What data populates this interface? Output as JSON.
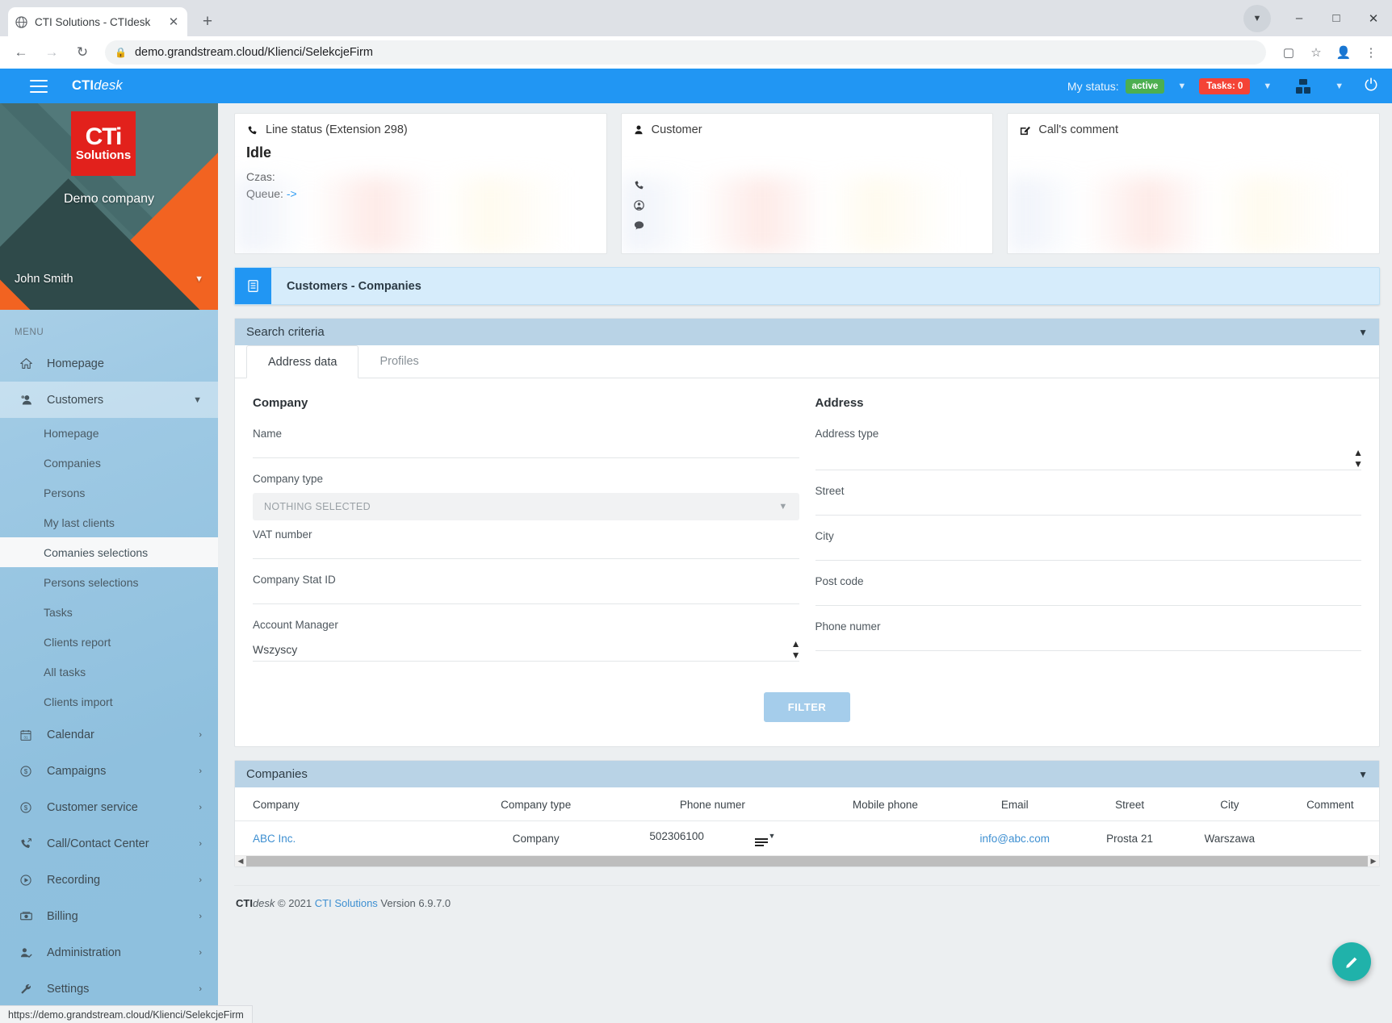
{
  "browser": {
    "tab_title": "CTI Solutions - CTIdesk",
    "tab_favicon": "globe-icon",
    "new_tab": "+",
    "url": "demo.grandstream.cloud/Klienci/SelekcjeFirm",
    "status_url": "https://demo.grandstream.cloud/Klienci/SelekcjeFirm",
    "minimize": "–",
    "maximize": "□",
    "close": "✕"
  },
  "topbar": {
    "brand_bold": "CTI",
    "brand_italic": "desk",
    "status_label": "My status:",
    "status_value": "active",
    "tasks_badge": "Tasks: 0",
    "accent_color": "#2196F3",
    "active_color": "#4CAF50",
    "tasks_color": "#f44336"
  },
  "sidebar": {
    "company": "Demo company",
    "user": "John Smith",
    "menu_label": "MENU",
    "items": [
      {
        "label": "Homepage",
        "icon": "home-icon",
        "chevron": ""
      },
      {
        "label": "Customers",
        "icon": "user-group-icon",
        "chevron": "⌄"
      }
    ],
    "sub_items": [
      {
        "label": "Homepage"
      },
      {
        "label": "Companies"
      },
      {
        "label": "Persons"
      },
      {
        "label": "My last clients"
      },
      {
        "label": "Comanies selections",
        "selected": true
      },
      {
        "label": "Persons selections"
      },
      {
        "label": "Tasks"
      },
      {
        "label": "Clients report"
      },
      {
        "label": "All tasks"
      },
      {
        "label": "Clients import"
      }
    ],
    "bottom_items": [
      {
        "label": "Calendar",
        "icon": "calendar-icon"
      },
      {
        "label": "Campaigns",
        "icon": "dollar-circle-icon"
      },
      {
        "label": "Customer service",
        "icon": "dollar-circle-icon"
      },
      {
        "label": "Call/Contact Center",
        "icon": "phone-call-icon"
      },
      {
        "label": "Recording",
        "icon": "play-circle-icon"
      },
      {
        "label": "Billing",
        "icon": "money-icon"
      },
      {
        "label": "Administration",
        "icon": "user-check-icon"
      },
      {
        "label": "Settings",
        "icon": "wrench-icon"
      }
    ]
  },
  "cards": {
    "line_status": {
      "title": "Line status (Extension 298)",
      "state": "Idle",
      "time_label": "Czas:",
      "queue_label": "Queue:",
      "queue_value": "->"
    },
    "customer": {
      "title": "Customer"
    },
    "comment": {
      "title": "Call's comment"
    }
  },
  "page": {
    "banner": "Customers - Companies",
    "search_panel_title": "Search criteria",
    "tabs": [
      {
        "label": "Address data",
        "active": true
      },
      {
        "label": "Profiles",
        "active": false
      }
    ],
    "company_section": "Company",
    "address_section": "Address",
    "fields_left": [
      {
        "label": "Name",
        "type": "text",
        "value": ""
      },
      {
        "label": "Company type",
        "type": "multiselect",
        "value": "NOTHING SELECTED"
      },
      {
        "label": "VAT number",
        "type": "text",
        "value": ""
      },
      {
        "label": "Company Stat ID",
        "type": "text",
        "value": ""
      },
      {
        "label": "Account Manager",
        "type": "select",
        "value": "Wszyscy"
      }
    ],
    "fields_right": [
      {
        "label": "Address type",
        "type": "select",
        "value": ""
      },
      {
        "label": "Street",
        "type": "text",
        "value": ""
      },
      {
        "label": "City",
        "type": "text",
        "value": ""
      },
      {
        "label": "Post code",
        "type": "text",
        "value": ""
      },
      {
        "label": "Phone numer",
        "type": "text",
        "value": ""
      }
    ],
    "filter_button": "FILTER"
  },
  "companies": {
    "panel_title": "Companies",
    "columns": [
      "Company",
      "Company type",
      "Phone numer",
      "Mobile phone",
      "Email",
      "Street",
      "City",
      "Comment"
    ],
    "rows": [
      {
        "company": "ABC Inc.",
        "company_type": "Company",
        "phone": "502306100",
        "mobile": "",
        "email": "info@abc.com",
        "street": "Prosta 21",
        "city": "Warszawa",
        "comment": ""
      }
    ]
  },
  "footer": {
    "brand_bold": "CTI",
    "brand_italic": "desk",
    "copyright": " © 2021 ",
    "link": "CTI Solutions",
    "version": " Version 6.9.7.0"
  }
}
